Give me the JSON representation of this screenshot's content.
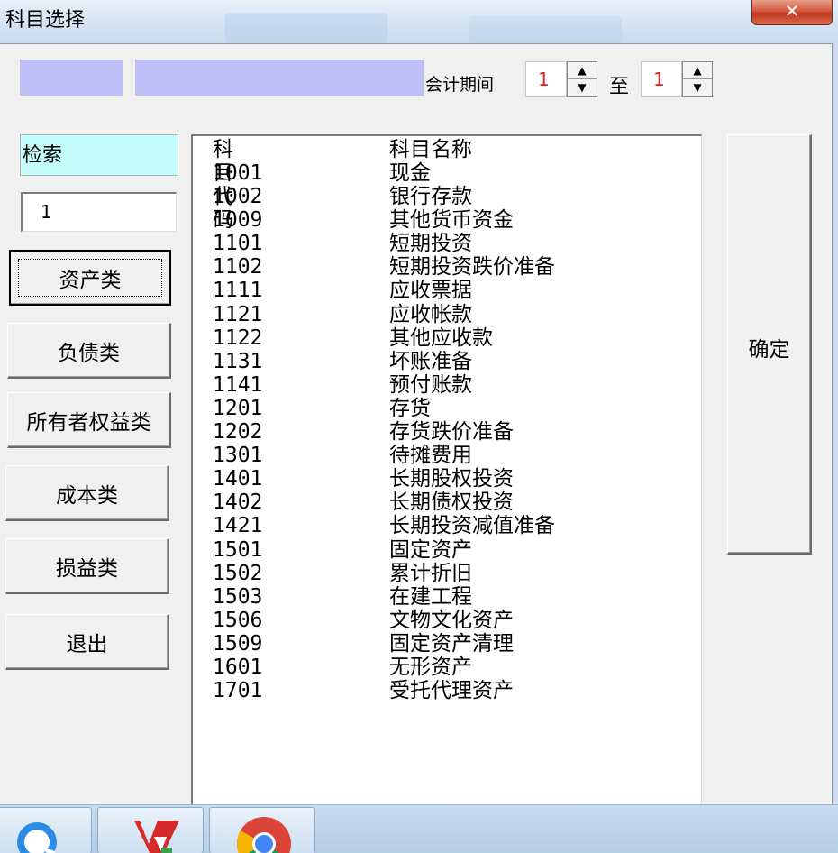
{
  "window": {
    "title": "科目选择",
    "close_glyph": "✕"
  },
  "period": {
    "label": "会计期间",
    "from_value": "1",
    "to_label": "至",
    "to_value": "1",
    "spin_up_glyph": "▲",
    "spin_down_glyph": "▼"
  },
  "search": {
    "label": "检索",
    "value": "1"
  },
  "category_buttons": [
    {
      "label": "资产类"
    },
    {
      "label": "负债类"
    },
    {
      "label": "所有者权益类"
    },
    {
      "label": "成本类"
    },
    {
      "label": "损益类"
    },
    {
      "label": "退出"
    }
  ],
  "confirm_label": "确定",
  "list": {
    "header_code": "科目代码",
    "header_name": "科目名称",
    "rows": [
      {
        "code": "1001",
        "name": "现金"
      },
      {
        "code": "1002",
        "name": "银行存款"
      },
      {
        "code": "1009",
        "name": "其他货币资金"
      },
      {
        "code": "1101",
        "name": "短期投资"
      },
      {
        "code": "1102",
        "name": "短期投资跌价准备"
      },
      {
        "code": "1111",
        "name": "应收票据"
      },
      {
        "code": "1121",
        "name": "应收帐款"
      },
      {
        "code": "1122",
        "name": "其他应收款"
      },
      {
        "code": "1131",
        "name": "坏账准备"
      },
      {
        "code": "1141",
        "name": "预付账款"
      },
      {
        "code": "1201",
        "name": "存货"
      },
      {
        "code": "1202",
        "name": "存货跌价准备"
      },
      {
        "code": "1301",
        "name": "待摊费用"
      },
      {
        "code": "1401",
        "name": "长期股权投资"
      },
      {
        "code": "1402",
        "name": "长期债权投资"
      },
      {
        "code": "1421",
        "name": "长期投资减值准备"
      },
      {
        "code": "1501",
        "name": "固定资产"
      },
      {
        "code": "1502",
        "name": "累计折旧"
      },
      {
        "code": "1503",
        "name": "在建工程"
      },
      {
        "code": "1506",
        "name": "文物文化资产"
      },
      {
        "code": "1509",
        "name": "固定资产清理"
      },
      {
        "code": "1601",
        "name": "无形资产"
      },
      {
        "code": "1701",
        "name": "受托代理资产"
      }
    ]
  },
  "taskbar": {
    "items": [
      {
        "icon": "qq-browser-icon"
      },
      {
        "icon": "wps-office-icon"
      },
      {
        "icon": "chrome-icon"
      }
    ]
  },
  "colors": {
    "search_label_bg": "#c4fbfb",
    "placeholder_box_bg": "#bfbff7",
    "spin_value_color": "#e02020",
    "close_button_red": "#c0381f"
  }
}
